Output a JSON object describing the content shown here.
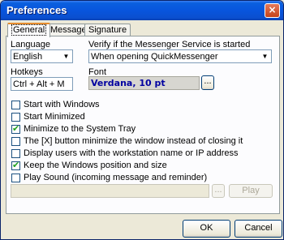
{
  "window": {
    "title": "Preferences",
    "close_glyph": "×"
  },
  "tabs": [
    {
      "label": "General",
      "active": true
    },
    {
      "label": "Message",
      "active": false
    },
    {
      "label": "Signature",
      "active": false
    }
  ],
  "language": {
    "label": "Language",
    "value": "English"
  },
  "verify": {
    "label": "Verify if the Messenger Service is started",
    "value": "When opening QuickMessenger"
  },
  "hotkeys": {
    "label": "Hotkeys",
    "value": "Ctrl + Alt + M"
  },
  "font": {
    "label": "Font",
    "value": "Verdana, 10 pt",
    "browse_label": "..."
  },
  "options": [
    {
      "label": "Start with Windows",
      "checked": false
    },
    {
      "label": "Start Minimized",
      "checked": false
    },
    {
      "label": "Minimize to the System Tray",
      "checked": true
    },
    {
      "label": "The [X] button minimize the window instead of closing it",
      "checked": false
    },
    {
      "label": "Display users with the workstation name or IP address",
      "checked": false
    },
    {
      "label": "Keep the Windows position and size",
      "checked": true
    },
    {
      "label": "Play Sound (incoming message and reminder)",
      "checked": false
    }
  ],
  "sound": {
    "browse_label": "...",
    "play_label": "Play"
  },
  "buttons": {
    "ok": "OK",
    "cancel": "Cancel"
  },
  "check_glyph": "✔",
  "dropdown_glyph": "▼",
  "colors": {
    "title_bar": "#0855dd",
    "dialog_bg": "#ece9d8",
    "font_text": "#0000a0",
    "check": "#21a121"
  }
}
